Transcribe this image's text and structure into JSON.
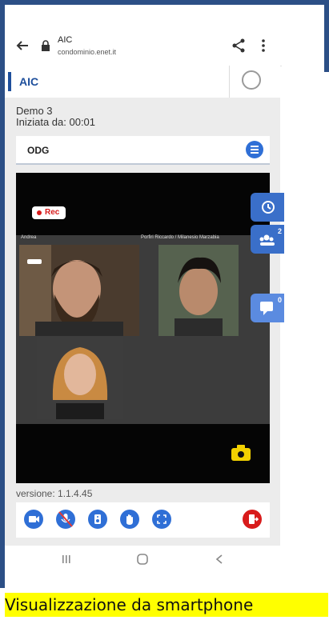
{
  "browser": {
    "title": "AIC",
    "host": "condominio.enet.it"
  },
  "app": {
    "title": "AIC"
  },
  "meeting": {
    "name": "Demo 3",
    "started": "Iniziata da: 00:01"
  },
  "odg": {
    "label": "ODG"
  },
  "video": {
    "rec_label": "Rec",
    "participant_1": "Andrea",
    "participant_2": "Porfiri Riccardo / Milanesio Marzabia"
  },
  "side_buttons": {
    "participants_count": "2",
    "chat_count": "0"
  },
  "version": "versione: 1.1.4.45",
  "caption": "Visualizzazione da smartphone",
  "colors": {
    "brand": "#1e4f9c",
    "accent_blue": "#2f6fd6",
    "side_blue": "#3a6fc9",
    "hangup": "#d81b1b",
    "caption_bg": "#ffff00"
  }
}
